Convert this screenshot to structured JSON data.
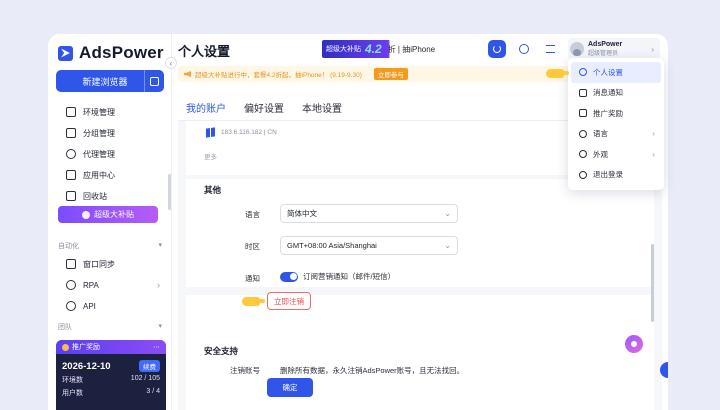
{
  "sidebar": {
    "logo_text": "AdsPower",
    "new_browser_label": "新建浏览器",
    "items": [
      {
        "label": "环境管理",
        "icon": "browser-window-icon"
      },
      {
        "label": "分组管理",
        "icon": "folder-icon"
      },
      {
        "label": "代理管理",
        "icon": "proxy-globe-icon"
      },
      {
        "label": "应用中心",
        "icon": "puzzle-icon"
      },
      {
        "label": "回收站",
        "icon": "trash-icon"
      }
    ],
    "promo_label": "超级大补贴",
    "automation_label": "自动化",
    "automation_items": [
      {
        "label": "窗口同步",
        "icon": "sync-windows-icon"
      },
      {
        "label": "RPA",
        "icon": "robot-icon"
      },
      {
        "label": "API",
        "icon": "api-link-icon"
      }
    ],
    "team_label": "团队",
    "card": {
      "header": "推广奖励",
      "date": "2026-12-10",
      "badge": "续费",
      "rows": [
        {
          "label": "环境数",
          "value": "102 / 105"
        },
        {
          "label": "用户数",
          "value": "3 / 4"
        }
      ]
    }
  },
  "header": {
    "title": "个人设置",
    "banner": {
      "left": "超级大补贴",
      "big": "4.2",
      "right": "折 | 抽iPhone"
    },
    "user": {
      "name": "AdsPower",
      "role": "超级管理员"
    }
  },
  "notice": {
    "text": "超级大补贴进行中，套餐4.2折起，抽iPhone！ (9.19-9.30)",
    "button": "立即参与"
  },
  "tabs": [
    {
      "label": "我的账户"
    },
    {
      "label": "偏好设置"
    },
    {
      "label": "本地设置"
    }
  ],
  "account": {
    "ip_line": "183.6.116.182 | CN",
    "more": "更多"
  },
  "other": {
    "title": "其他",
    "language_label": "语言",
    "language_value": "简体中文",
    "timezone_label": "时区",
    "timezone_value": "GMT+08:00 Asia/Shanghai",
    "notify_label": "通知",
    "notify_text": "订阅营销通知（邮件/短信）"
  },
  "security": {
    "title": "安全支持",
    "cancel_label": "注销账号",
    "cancel_desc": "删除所有数据，永久注销AdsPower账号，且无法找回。",
    "cancel_button": "立即注销",
    "confirm_button": "确定"
  },
  "user_menu": {
    "items": [
      {
        "label": "个人设置",
        "icon": "user-icon",
        "active": true
      },
      {
        "label": "消息通知",
        "icon": "bell-icon"
      },
      {
        "label": "推广奖励",
        "icon": "gift-icon"
      },
      {
        "label": "语言",
        "icon": "globe-icon",
        "submenu": true
      },
      {
        "label": "外观",
        "icon": "theme-icon",
        "submenu": true
      },
      {
        "label": "退出登录",
        "icon": "logout-icon"
      }
    ]
  },
  "colors": {
    "primary": "#2f56e8",
    "danger": "#f04848",
    "notice": "#e69320",
    "promo": "#7b4dff"
  }
}
